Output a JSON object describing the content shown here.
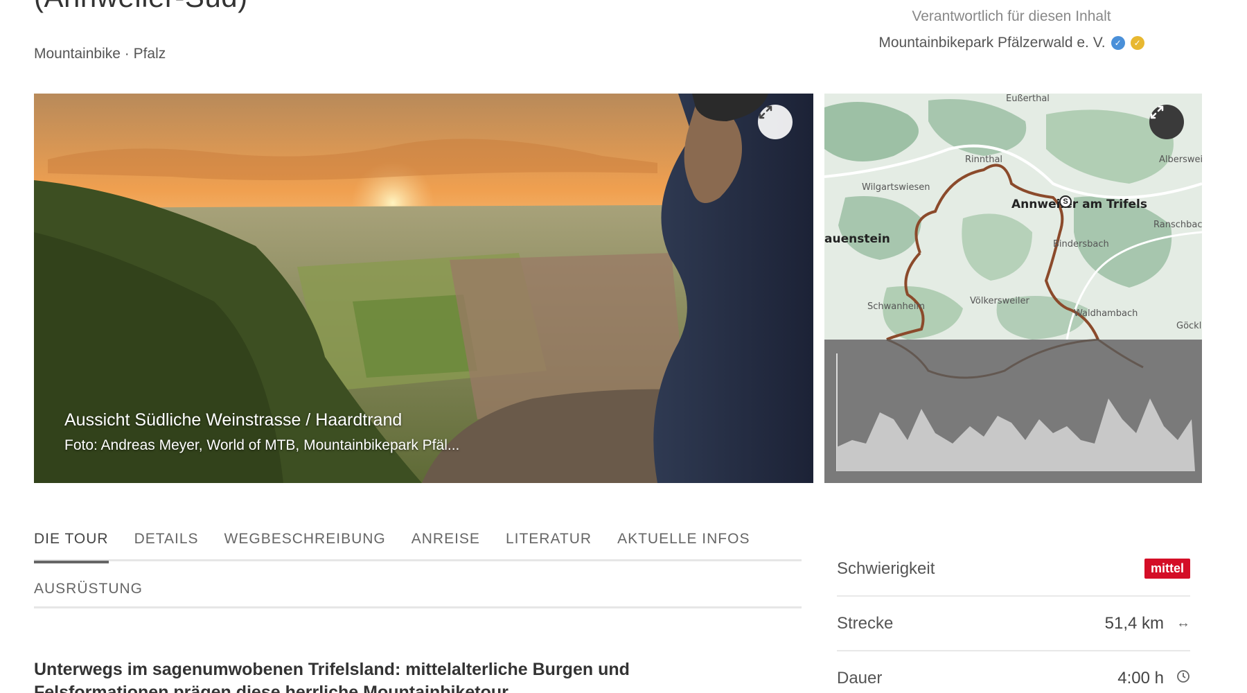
{
  "header": {
    "title": "(Annweiler-Süd)",
    "subtitle": "Mountainbike · Pfalz"
  },
  "responsible": {
    "label": "Verantwortlich für diesen Inhalt",
    "organization": "Mountainbikepark Pfälzerwald e. V."
  },
  "photo": {
    "caption": "Aussicht Südliche Weinstrasse / Haardtrand",
    "credit": "Foto: Andreas Meyer, World of MTB, Mountainbikepark Pfäl..."
  },
  "map": {
    "labels": {
      "top": "Eußerthal",
      "rinnthal": "Rinnthal",
      "wilgartswiesen": "Wilgartswiesen",
      "annweiler": "Annweiler am Trifels",
      "albersweiler": "Albersweiler",
      "ranschbach": "Ranschbach",
      "lauenstein": "auenstein",
      "bindersbach": "Bindersbach",
      "schwanheim": "Schwanheim",
      "voelkersweiler": "Völkersweiler",
      "waldhambach": "Waldhambach",
      "goecklingen": "Göckl"
    },
    "start_marker": "S"
  },
  "tabs": {
    "row1": [
      "DIE TOUR",
      "DETAILS",
      "WEGBESCHREIBUNG",
      "ANREISE",
      "LITERATUR",
      "AKTUELLE INFOS"
    ],
    "row2": [
      "AUSRÜSTUNG"
    ],
    "active": "DIE TOUR"
  },
  "intro": {
    "text": "Unterwegs im sagenumwobenen Trifelsland: mittelalterliche Burgen und Felsformationen prägen diese herrliche Mountainbiketour"
  },
  "facts": {
    "difficulty_label": "Schwierigkeit",
    "difficulty_value": "mittel",
    "distance_label": "Strecke",
    "distance_value": "51,4 km",
    "duration_label": "Dauer",
    "duration_value": "4:00 h"
  },
  "icons": {
    "expand": "expand-icon",
    "verified": "verified-badge-icon",
    "award": "award-badge-icon",
    "distance": "arrows-horizontal-icon",
    "duration": "clock-icon"
  },
  "colors": {
    "difficulty": "#d40e27",
    "route": "#8b4a2b"
  }
}
